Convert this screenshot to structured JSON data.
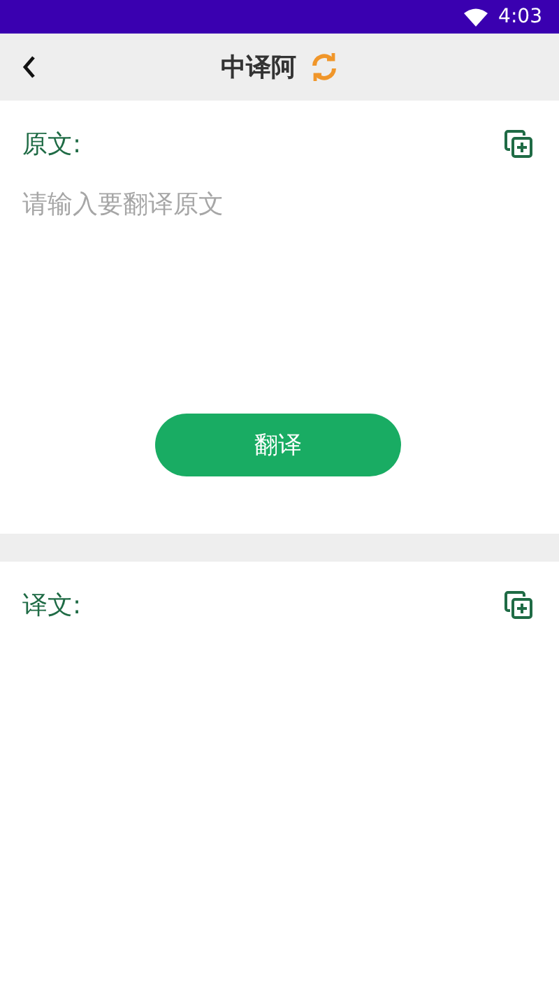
{
  "status_bar": {
    "time": "4:03"
  },
  "app_bar": {
    "title": "中译阿"
  },
  "source": {
    "label": "原文:",
    "placeholder": "请输入要翻译原文"
  },
  "translate_button": {
    "label": "翻译"
  },
  "output": {
    "label": "译文:"
  }
}
